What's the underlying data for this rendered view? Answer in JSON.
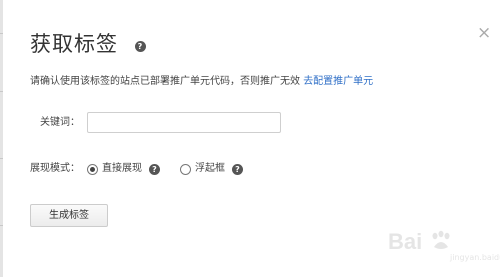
{
  "dialog": {
    "title": "获取标签",
    "close_glyph": "×",
    "help_glyph": "?",
    "notice_text": "请确认使用该标签的站点已部署推广单元代码，否则推广无效",
    "notice_link": "去配置推广单元"
  },
  "keyword": {
    "label": "关键词：",
    "value": "",
    "placeholder": ""
  },
  "display_mode": {
    "label": "展现模式：",
    "options": [
      {
        "label": "直接展现",
        "selected": true
      },
      {
        "label": "浮起框",
        "selected": false
      }
    ]
  },
  "actions": {
    "generate_label": "生成标签"
  },
  "watermark": {
    "text": "Bai",
    "sub": "jingyan.baidu.com"
  },
  "colors": {
    "link": "#2f6fc7",
    "text": "#333333",
    "border": "#cfcfcf"
  }
}
